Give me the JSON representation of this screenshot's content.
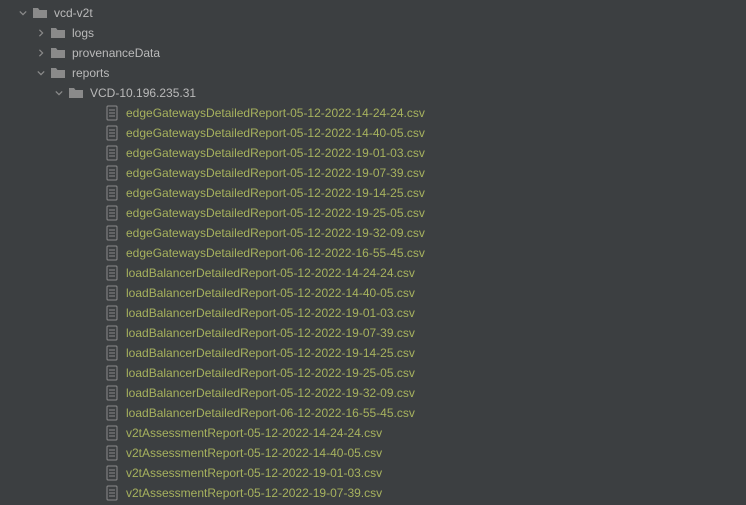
{
  "colors": {
    "highlight": "#a7b25e",
    "normal": "#bababa",
    "iconGray": "#8a8a8a"
  },
  "tree": {
    "root": {
      "name": "vcd-v2t",
      "expanded": true,
      "type": "folder"
    },
    "children": [
      {
        "name": "logs",
        "type": "folder",
        "expanded": false,
        "hasChildren": true
      },
      {
        "name": "provenanceData",
        "type": "folder",
        "expanded": false,
        "hasChildren": true
      },
      {
        "name": "reports",
        "type": "folder",
        "expanded": true,
        "hasChildren": true
      }
    ],
    "reports_child": {
      "name": "VCD-10.196.235.31",
      "type": "folder",
      "expanded": true
    },
    "files": [
      {
        "name": "edgeGatewaysDetailedReport-05-12-2022-14-24-24.csv",
        "highlight": true
      },
      {
        "name": "edgeGatewaysDetailedReport-05-12-2022-14-40-05.csv",
        "highlight": true
      },
      {
        "name": "edgeGatewaysDetailedReport-05-12-2022-19-01-03.csv",
        "highlight": true
      },
      {
        "name": "edgeGatewaysDetailedReport-05-12-2022-19-07-39.csv",
        "highlight": true
      },
      {
        "name": "edgeGatewaysDetailedReport-05-12-2022-19-14-25.csv",
        "highlight": true
      },
      {
        "name": "edgeGatewaysDetailedReport-05-12-2022-19-25-05.csv",
        "highlight": true
      },
      {
        "name": "edgeGatewaysDetailedReport-05-12-2022-19-32-09.csv",
        "highlight": true
      },
      {
        "name": "edgeGatewaysDetailedReport-06-12-2022-16-55-45.csv",
        "highlight": true
      },
      {
        "name": "loadBalancerDetailedReport-05-12-2022-14-24-24.csv",
        "highlight": true
      },
      {
        "name": "loadBalancerDetailedReport-05-12-2022-14-40-05.csv",
        "highlight": true
      },
      {
        "name": "loadBalancerDetailedReport-05-12-2022-19-01-03.csv",
        "highlight": true
      },
      {
        "name": "loadBalancerDetailedReport-05-12-2022-19-07-39.csv",
        "highlight": true
      },
      {
        "name": "loadBalancerDetailedReport-05-12-2022-19-14-25.csv",
        "highlight": true
      },
      {
        "name": "loadBalancerDetailedReport-05-12-2022-19-25-05.csv",
        "highlight": true
      },
      {
        "name": "loadBalancerDetailedReport-05-12-2022-19-32-09.csv",
        "highlight": true
      },
      {
        "name": "loadBalancerDetailedReport-06-12-2022-16-55-45.csv",
        "highlight": true
      },
      {
        "name": "v2tAssessmentReport-05-12-2022-14-24-24.csv",
        "highlight": true
      },
      {
        "name": "v2tAssessmentReport-05-12-2022-14-40-05.csv",
        "highlight": true
      },
      {
        "name": "v2tAssessmentReport-05-12-2022-19-01-03.csv",
        "highlight": true
      },
      {
        "name": "v2tAssessmentReport-05-12-2022-19-07-39.csv",
        "highlight": true
      }
    ]
  }
}
